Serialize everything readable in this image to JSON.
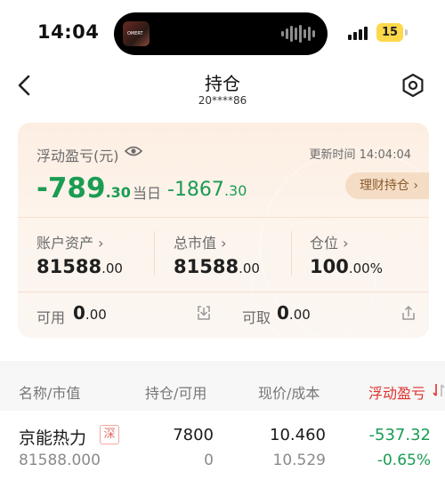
{
  "status_bar": {
    "time": "14:04",
    "battery": "15",
    "album_art_text": "OMERT"
  },
  "nav": {
    "title": "持仓",
    "account": "20****86"
  },
  "summary": {
    "pnl_label": "浮动盈亏(元)",
    "update_time": "更新时间 14:04:04",
    "pnl_int": "-789",
    "pnl_dec": ".30",
    "day_label": "当日",
    "day_int": "-1867",
    "day_dec": ".30",
    "finance_button": "理财持仓 ›",
    "assets_label": "账户资产 ›",
    "assets_int": "81588",
    "assets_dec": ".00",
    "market_label": "总市值 ›",
    "market_int": "81588",
    "market_dec": ".00",
    "position_label": "仓位 ›",
    "position_int": "100",
    "position_dec": ".00%",
    "available_label": "可用",
    "available_int": "0",
    "available_dec": ".00",
    "withdrawable_label": "可取",
    "withdrawable_int": "0",
    "withdrawable_dec": ".00"
  },
  "table": {
    "headers": [
      "名称/市值",
      "持仓/可用",
      "现价/成本",
      "浮动盈亏"
    ],
    "rows": [
      {
        "name": "京能热力",
        "exchange_tag": "深",
        "market_value": "81588.000",
        "position": "7800",
        "available": "0",
        "price": "10.460",
        "cost": "10.529",
        "pnl": "-537.32",
        "pnl_pct": "-0.65%"
      }
    ]
  },
  "colors": {
    "gain_loss_green": "#1a9c53",
    "active_header_red": "#e0312c",
    "card_bg": "#fdeee2"
  },
  "icons": [
    "back-icon",
    "settings-hexagon-icon",
    "eye-icon",
    "transfer-in-icon",
    "transfer-out-icon",
    "sort-icon"
  ]
}
